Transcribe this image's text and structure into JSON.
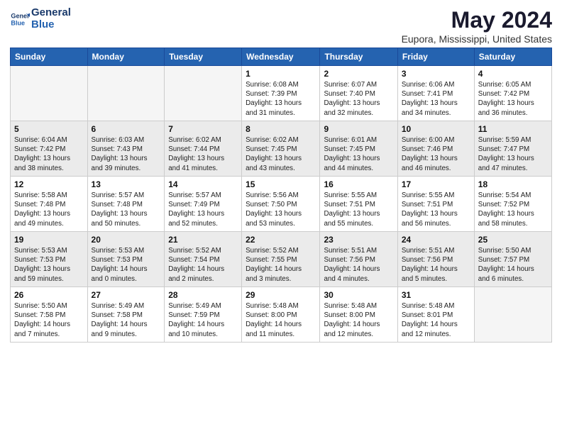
{
  "header": {
    "logo_line1": "General",
    "logo_line2": "Blue",
    "title": "May 2024",
    "subtitle": "Eupora, Mississippi, United States"
  },
  "columns": [
    "Sunday",
    "Monday",
    "Tuesday",
    "Wednesday",
    "Thursday",
    "Friday",
    "Saturday"
  ],
  "weeks": [
    [
      {
        "day": "",
        "info": ""
      },
      {
        "day": "",
        "info": ""
      },
      {
        "day": "",
        "info": ""
      },
      {
        "day": "1",
        "info": "Sunrise: 6:08 AM\nSunset: 7:39 PM\nDaylight: 13 hours\nand 31 minutes."
      },
      {
        "day": "2",
        "info": "Sunrise: 6:07 AM\nSunset: 7:40 PM\nDaylight: 13 hours\nand 32 minutes."
      },
      {
        "day": "3",
        "info": "Sunrise: 6:06 AM\nSunset: 7:41 PM\nDaylight: 13 hours\nand 34 minutes."
      },
      {
        "day": "4",
        "info": "Sunrise: 6:05 AM\nSunset: 7:42 PM\nDaylight: 13 hours\nand 36 minutes."
      }
    ],
    [
      {
        "day": "5",
        "info": "Sunrise: 6:04 AM\nSunset: 7:42 PM\nDaylight: 13 hours\nand 38 minutes."
      },
      {
        "day": "6",
        "info": "Sunrise: 6:03 AM\nSunset: 7:43 PM\nDaylight: 13 hours\nand 39 minutes."
      },
      {
        "day": "7",
        "info": "Sunrise: 6:02 AM\nSunset: 7:44 PM\nDaylight: 13 hours\nand 41 minutes."
      },
      {
        "day": "8",
        "info": "Sunrise: 6:02 AM\nSunset: 7:45 PM\nDaylight: 13 hours\nand 43 minutes."
      },
      {
        "day": "9",
        "info": "Sunrise: 6:01 AM\nSunset: 7:45 PM\nDaylight: 13 hours\nand 44 minutes."
      },
      {
        "day": "10",
        "info": "Sunrise: 6:00 AM\nSunset: 7:46 PM\nDaylight: 13 hours\nand 46 minutes."
      },
      {
        "day": "11",
        "info": "Sunrise: 5:59 AM\nSunset: 7:47 PM\nDaylight: 13 hours\nand 47 minutes."
      }
    ],
    [
      {
        "day": "12",
        "info": "Sunrise: 5:58 AM\nSunset: 7:48 PM\nDaylight: 13 hours\nand 49 minutes."
      },
      {
        "day": "13",
        "info": "Sunrise: 5:57 AM\nSunset: 7:48 PM\nDaylight: 13 hours\nand 50 minutes."
      },
      {
        "day": "14",
        "info": "Sunrise: 5:57 AM\nSunset: 7:49 PM\nDaylight: 13 hours\nand 52 minutes."
      },
      {
        "day": "15",
        "info": "Sunrise: 5:56 AM\nSunset: 7:50 PM\nDaylight: 13 hours\nand 53 minutes."
      },
      {
        "day": "16",
        "info": "Sunrise: 5:55 AM\nSunset: 7:51 PM\nDaylight: 13 hours\nand 55 minutes."
      },
      {
        "day": "17",
        "info": "Sunrise: 5:55 AM\nSunset: 7:51 PM\nDaylight: 13 hours\nand 56 minutes."
      },
      {
        "day": "18",
        "info": "Sunrise: 5:54 AM\nSunset: 7:52 PM\nDaylight: 13 hours\nand 58 minutes."
      }
    ],
    [
      {
        "day": "19",
        "info": "Sunrise: 5:53 AM\nSunset: 7:53 PM\nDaylight: 13 hours\nand 59 minutes."
      },
      {
        "day": "20",
        "info": "Sunrise: 5:53 AM\nSunset: 7:53 PM\nDaylight: 14 hours\nand 0 minutes."
      },
      {
        "day": "21",
        "info": "Sunrise: 5:52 AM\nSunset: 7:54 PM\nDaylight: 14 hours\nand 2 minutes."
      },
      {
        "day": "22",
        "info": "Sunrise: 5:52 AM\nSunset: 7:55 PM\nDaylight: 14 hours\nand 3 minutes."
      },
      {
        "day": "23",
        "info": "Sunrise: 5:51 AM\nSunset: 7:56 PM\nDaylight: 14 hours\nand 4 minutes."
      },
      {
        "day": "24",
        "info": "Sunrise: 5:51 AM\nSunset: 7:56 PM\nDaylight: 14 hours\nand 5 minutes."
      },
      {
        "day": "25",
        "info": "Sunrise: 5:50 AM\nSunset: 7:57 PM\nDaylight: 14 hours\nand 6 minutes."
      }
    ],
    [
      {
        "day": "26",
        "info": "Sunrise: 5:50 AM\nSunset: 7:58 PM\nDaylight: 14 hours\nand 7 minutes."
      },
      {
        "day": "27",
        "info": "Sunrise: 5:49 AM\nSunset: 7:58 PM\nDaylight: 14 hours\nand 9 minutes."
      },
      {
        "day": "28",
        "info": "Sunrise: 5:49 AM\nSunset: 7:59 PM\nDaylight: 14 hours\nand 10 minutes."
      },
      {
        "day": "29",
        "info": "Sunrise: 5:48 AM\nSunset: 8:00 PM\nDaylight: 14 hours\nand 11 minutes."
      },
      {
        "day": "30",
        "info": "Sunrise: 5:48 AM\nSunset: 8:00 PM\nDaylight: 14 hours\nand 12 minutes."
      },
      {
        "day": "31",
        "info": "Sunrise: 5:48 AM\nSunset: 8:01 PM\nDaylight: 14 hours\nand 12 minutes."
      },
      {
        "day": "",
        "info": ""
      }
    ]
  ]
}
